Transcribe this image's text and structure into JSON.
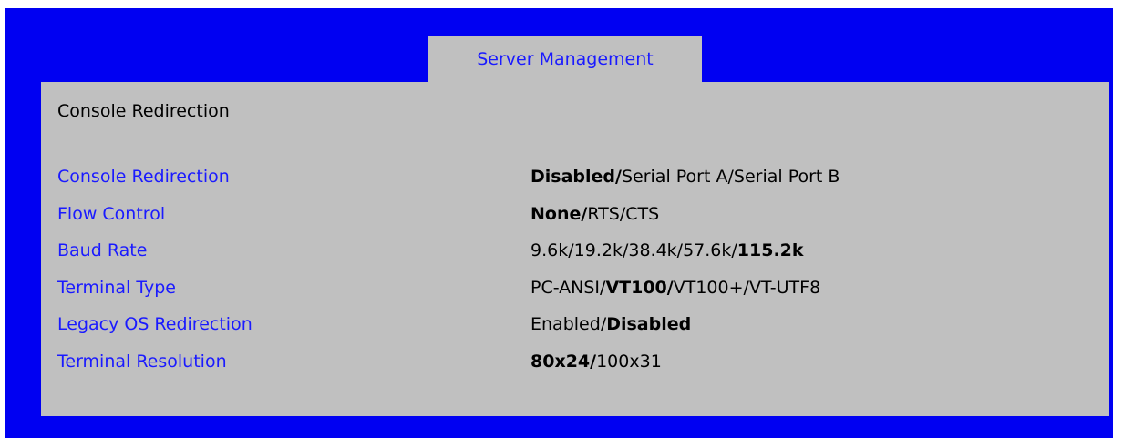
{
  "tab": {
    "label": "Server Management"
  },
  "section_title": "Console Redirection",
  "settings": [
    {
      "label": "Console Redirection",
      "options": [
        "Disabled",
        "Serial Port A",
        "Serial Port B"
      ],
      "selected": 0
    },
    {
      "label": "Flow Control",
      "options": [
        "None",
        "RTS/CTS"
      ],
      "selected": 0
    },
    {
      "label": "Baud Rate",
      "options": [
        "9.6k",
        "19.2k",
        "38.4k",
        "57.6k",
        "115.2k"
      ],
      "selected": 4
    },
    {
      "label": "Terminal Type",
      "options": [
        "PC-ANSI",
        "VT100",
        "VT100+",
        "VT-UTF8"
      ],
      "selected": 1
    },
    {
      "label": "Legacy OS Redirection",
      "options": [
        "Enabled",
        "Disabled"
      ],
      "selected": 1
    },
    {
      "label": "Terminal Resolution",
      "options": [
        "80x24",
        "100x31"
      ],
      "selected": 0
    }
  ]
}
